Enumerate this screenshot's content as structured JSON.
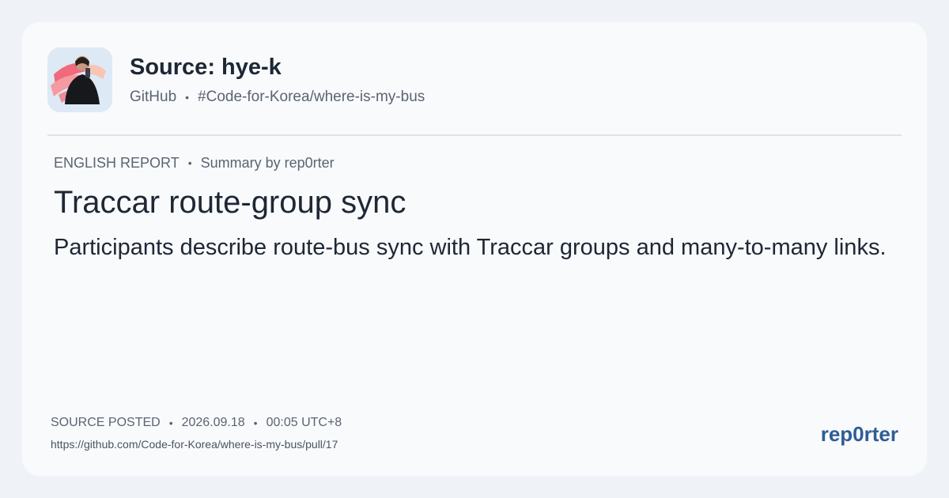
{
  "source": {
    "title": "Source: hye-k",
    "platform": "GitHub",
    "repo": "#Code-for-Korea/where-is-my-bus",
    "separator": "•"
  },
  "report": {
    "label": "ENGLISH REPORT",
    "summary_by": "Summary by rep0rter",
    "headline": "Traccar route-group sync",
    "summary": "Participants describe route-bus sync with Traccar groups and many-to-many links."
  },
  "footer": {
    "posted_label": "SOURCE POSTED",
    "date": "2026.09.18",
    "time": "00:05 UTC+8",
    "url": "https://github.com/Code-for-Korea/where-is-my-bus/pull/17",
    "brand": "rep0rter"
  },
  "colors": {
    "background": "#eff2f6",
    "card": "#f9fafc",
    "text": "#1d2735",
    "muted": "#5a6472",
    "brand": "#2e5d96"
  },
  "icons": {
    "avatar": "user-avatar-photo"
  }
}
